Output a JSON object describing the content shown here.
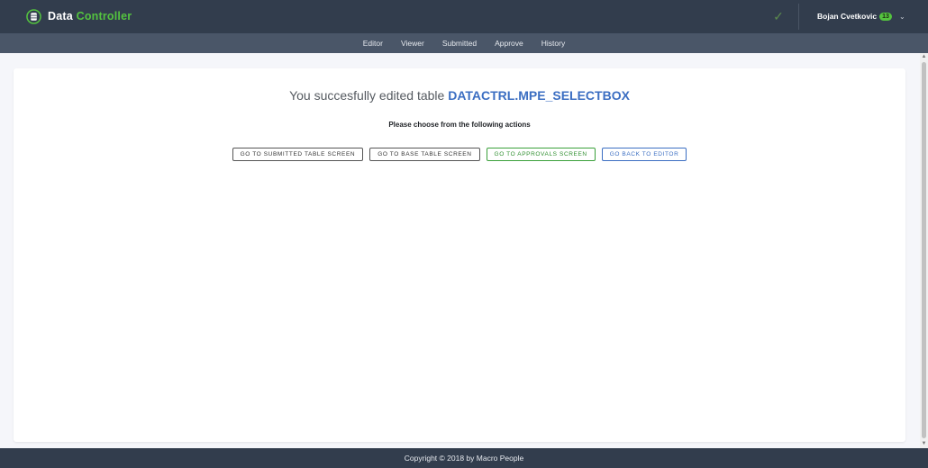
{
  "header": {
    "logo_word1": "Data",
    "logo_word2": "Controller",
    "user_name": "Bojan Cvetkovic",
    "user_badge": "13"
  },
  "nav": {
    "items": [
      "Editor",
      "Viewer",
      "Submitted",
      "Approve",
      "History"
    ]
  },
  "main": {
    "headline_prefix": "You succesfully edited table",
    "table_name": "DATACTRL.MPE_SELECTBOX",
    "subheading": "Please choose from the following actions",
    "buttons": [
      "GO TO SUBMITTED TABLE SCREEN",
      "GO TO BASE TABLE SCREEN",
      "GO TO APPROVALS SCREEN",
      "GO BACK TO EDITOR"
    ]
  },
  "footer": {
    "copyright": "Copyright © 2018 by Macro People"
  },
  "icons": {
    "logo": "database-icon",
    "check": "check-icon",
    "user_menu": "chevron-down-icon"
  },
  "colors": {
    "header_bg": "#323d4d",
    "subnav_bg": "#4a5668",
    "brand_green": "#54c33f",
    "link_blue": "#3b6ec2"
  }
}
